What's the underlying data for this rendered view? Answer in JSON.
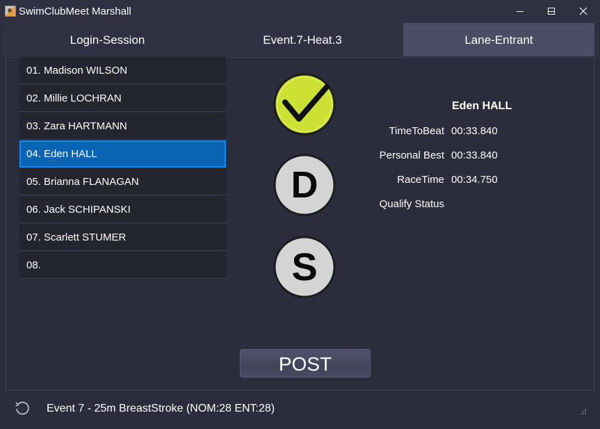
{
  "window": {
    "title": "SwimClubMeet Marshall",
    "icon": "app-icon"
  },
  "tabs": [
    {
      "label": "Login-Session",
      "active": false
    },
    {
      "label": "Event.7-Heat.3",
      "active": false
    },
    {
      "label": "Lane-Entrant",
      "active": true
    }
  ],
  "lanes": [
    {
      "label": "01. Madison WILSON",
      "selected": false
    },
    {
      "label": "02. Millie LOCHRAN",
      "selected": false
    },
    {
      "label": "03. Zara HARTMANN",
      "selected": false
    },
    {
      "label": "04. Eden HALL",
      "selected": true
    },
    {
      "label": "05. Brianna FLANAGAN",
      "selected": false
    },
    {
      "label": "06. Jack SCHIPANSKI",
      "selected": false
    },
    {
      "label": "07. Scarlett STUMER",
      "selected": false
    },
    {
      "label": "08.",
      "selected": false
    }
  ],
  "actions": {
    "check_icon": "checkmark-icon",
    "dq_letter": "D",
    "scratch_letter": "S",
    "post_label": "POST"
  },
  "entrant": {
    "name": "Eden HALL",
    "time_to_beat_label": "TimeToBeat",
    "time_to_beat": "00:33.840",
    "personal_best_label": "Personal Best",
    "personal_best": "00:33.840",
    "race_time_label": "RaceTime",
    "race_time": "00:34.750",
    "qualify_status_label": "Qualify Status",
    "qualify_status": ""
  },
  "status": {
    "text": "Event 7 - 25m BreastStroke (NOM:28 ENT:28)",
    "refresh_icon": "refresh-icon"
  },
  "colors": {
    "background": "#2b2d3c",
    "selected": "#0a64b4",
    "check_green": "#cde135",
    "tab_active": "#4a4d64"
  }
}
